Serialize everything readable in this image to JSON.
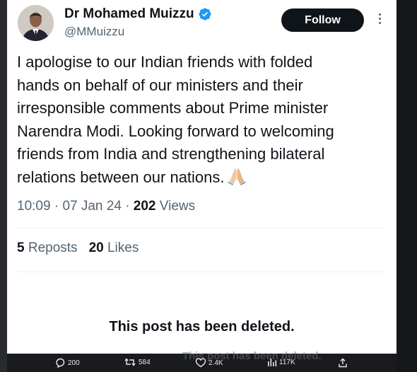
{
  "author": {
    "name": "Dr Mohamed Muizzu",
    "handle": "@MMuizzu"
  },
  "follow_label": "Follow",
  "tweet": {
    "lines": [
      "I apologise to our Indian friends with folded",
      "hands on behalf of our ministers and their",
      "irresponsible comments about Prime minister",
      "Narendra Modi. Looking forward to welcoming",
      "friends from India and strengthening bilateral",
      "relations between our nations."
    ],
    "emoji": "folded-hands-emoji"
  },
  "meta": {
    "time": "10:09",
    "date": "07 Jan 24",
    "separator": "·",
    "views_count": "202",
    "views_label": "Views"
  },
  "stats": {
    "reposts_count": "5",
    "reposts_label": "Reposts",
    "likes_count": "20",
    "likes_label": "Likes"
  },
  "deleted_notice": "This post has been deleted.",
  "bottom_bar": {
    "replies": "200",
    "reposts": "584",
    "likes": "2.4K",
    "views": "117K",
    "ghost_text": "This post has been deleted."
  },
  "colors": {
    "verified": "#1d9bf0",
    "follow_bg": "#0f1419",
    "secondary_text": "#536471"
  }
}
